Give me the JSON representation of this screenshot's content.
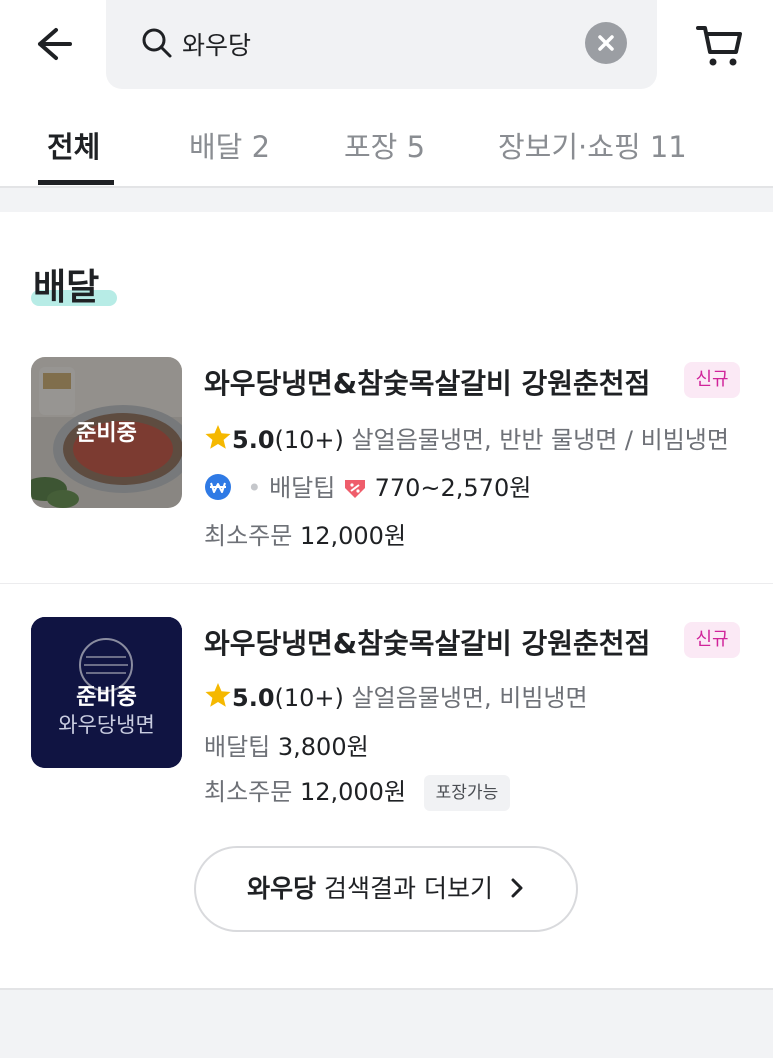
{
  "header": {
    "search_value": "와우당",
    "search_placeholder": "",
    "icons": {
      "back": "back-arrow-icon",
      "search": "search-icon",
      "clear": "clear-icon",
      "cart": "cart-icon"
    }
  },
  "tabs": [
    {
      "label": "전체",
      "active": true
    },
    {
      "label": "배달 2",
      "active": false
    },
    {
      "label": "포장 5",
      "active": false
    },
    {
      "label": "장보기·쇼핑 11",
      "active": false
    }
  ],
  "section": {
    "title": "배달"
  },
  "stores": [
    {
      "name": "와우당냉면&참숯목살갈비 강원춘천점",
      "badge": "신규",
      "thumb_label": "준비중",
      "rating": "5.0",
      "review_count": "(10+)",
      "menu": "살얼음물냉면, 반반 물냉면 / 비빔냉면",
      "tip_label": "배달팁",
      "tip_value": "770~2,570원",
      "min_order_label": "최소주문",
      "min_order_value": "12,000원"
    },
    {
      "name": "와우당냉면&참숯목살갈비 강원춘천점",
      "badge": "신규",
      "thumb_label": "준비중",
      "logo_text": "와우당냉면",
      "rating": "5.0",
      "review_count": "(10+)",
      "menu": "살얼음물냉면, 비빔냉면",
      "tip_label": "배달팁",
      "tip_value": "3,800원",
      "min_order_label": "최소주문",
      "min_order_value": "12,000원",
      "extra_badge": "포장가능"
    }
  ],
  "more_button": {
    "keyword": "와우당",
    "label": "검색결과 더보기"
  },
  "colors": {
    "accent_new": "#d0249a",
    "section_highlight": "#b7ece6",
    "star": "#f5b800",
    "logo_bg": "#0f1450"
  }
}
